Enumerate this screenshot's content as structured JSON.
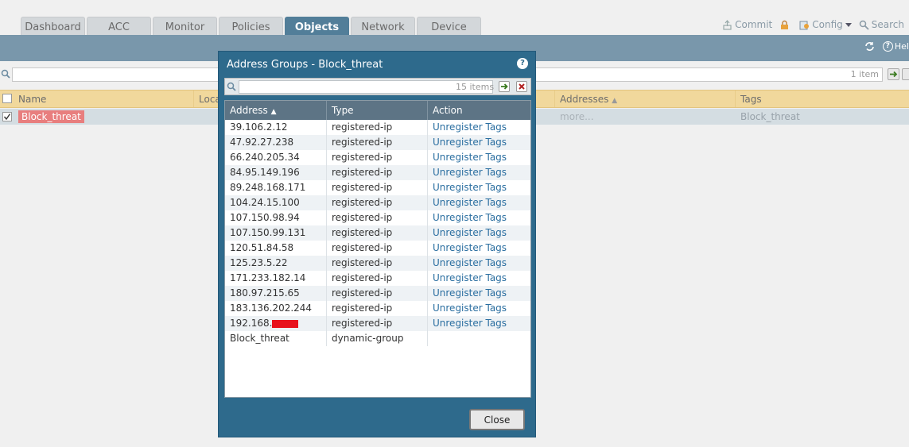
{
  "tabs": [
    {
      "label": "Dashboard",
      "active": false
    },
    {
      "label": "ACC",
      "active": false
    },
    {
      "label": "Monitor",
      "active": false
    },
    {
      "label": "Policies",
      "active": false
    },
    {
      "label": "Objects",
      "active": true
    },
    {
      "label": "Network",
      "active": false
    },
    {
      "label": "Device",
      "active": false
    }
  ],
  "top_actions": {
    "commit": "Commit",
    "config": "Config",
    "search": "Search"
  },
  "band": {
    "help_partial": "Hel"
  },
  "filter": {
    "count": "1 item"
  },
  "main_table": {
    "headers": {
      "name": "Name",
      "location": "Loca",
      "addresses": "Addresses",
      "tags": "Tags"
    },
    "row": {
      "name": "Block_threat",
      "addresses": "more...",
      "tags": "Block_threat"
    }
  },
  "modal": {
    "title": "Address Groups - Block_threat",
    "search_count": "15 items",
    "headers": {
      "address": "Address",
      "type": "Type",
      "action": "Action"
    },
    "rows": [
      {
        "address": "39.106.2.12",
        "type": "registered-ip",
        "action": "Unregister Tags"
      },
      {
        "address": "47.92.27.238",
        "type": "registered-ip",
        "action": "Unregister Tags"
      },
      {
        "address": "66.240.205.34",
        "type": "registered-ip",
        "action": "Unregister Tags"
      },
      {
        "address": "84.95.149.196",
        "type": "registered-ip",
        "action": "Unregister Tags"
      },
      {
        "address": "89.248.168.171",
        "type": "registered-ip",
        "action": "Unregister Tags"
      },
      {
        "address": "104.24.15.100",
        "type": "registered-ip",
        "action": "Unregister Tags"
      },
      {
        "address": "107.150.98.94",
        "type": "registered-ip",
        "action": "Unregister Tags"
      },
      {
        "address": "107.150.99.131",
        "type": "registered-ip",
        "action": "Unregister Tags"
      },
      {
        "address": "120.51.84.58",
        "type": "registered-ip",
        "action": "Unregister Tags"
      },
      {
        "address": "125.23.5.22",
        "type": "registered-ip",
        "action": "Unregister Tags"
      },
      {
        "address": "171.233.182.14",
        "type": "registered-ip",
        "action": "Unregister Tags"
      },
      {
        "address": "180.97.215.65",
        "type": "registered-ip",
        "action": "Unregister Tags"
      },
      {
        "address": "183.136.202.244",
        "type": "registered-ip",
        "action": "Unregister Tags"
      },
      {
        "address": "192.168.",
        "type": "registered-ip",
        "action": "Unregister Tags",
        "redacted": true
      },
      {
        "address": "Block_threat",
        "type": "dynamic-group",
        "action": ""
      }
    ],
    "close_label": "Close"
  },
  "colors": {
    "tab_active": "#527e99",
    "band": "#7997ab",
    "modal": "#2e6a8c",
    "header_yellow": "#f1d89c",
    "link": "#2a6ea0",
    "badge": "#e87e7e"
  }
}
